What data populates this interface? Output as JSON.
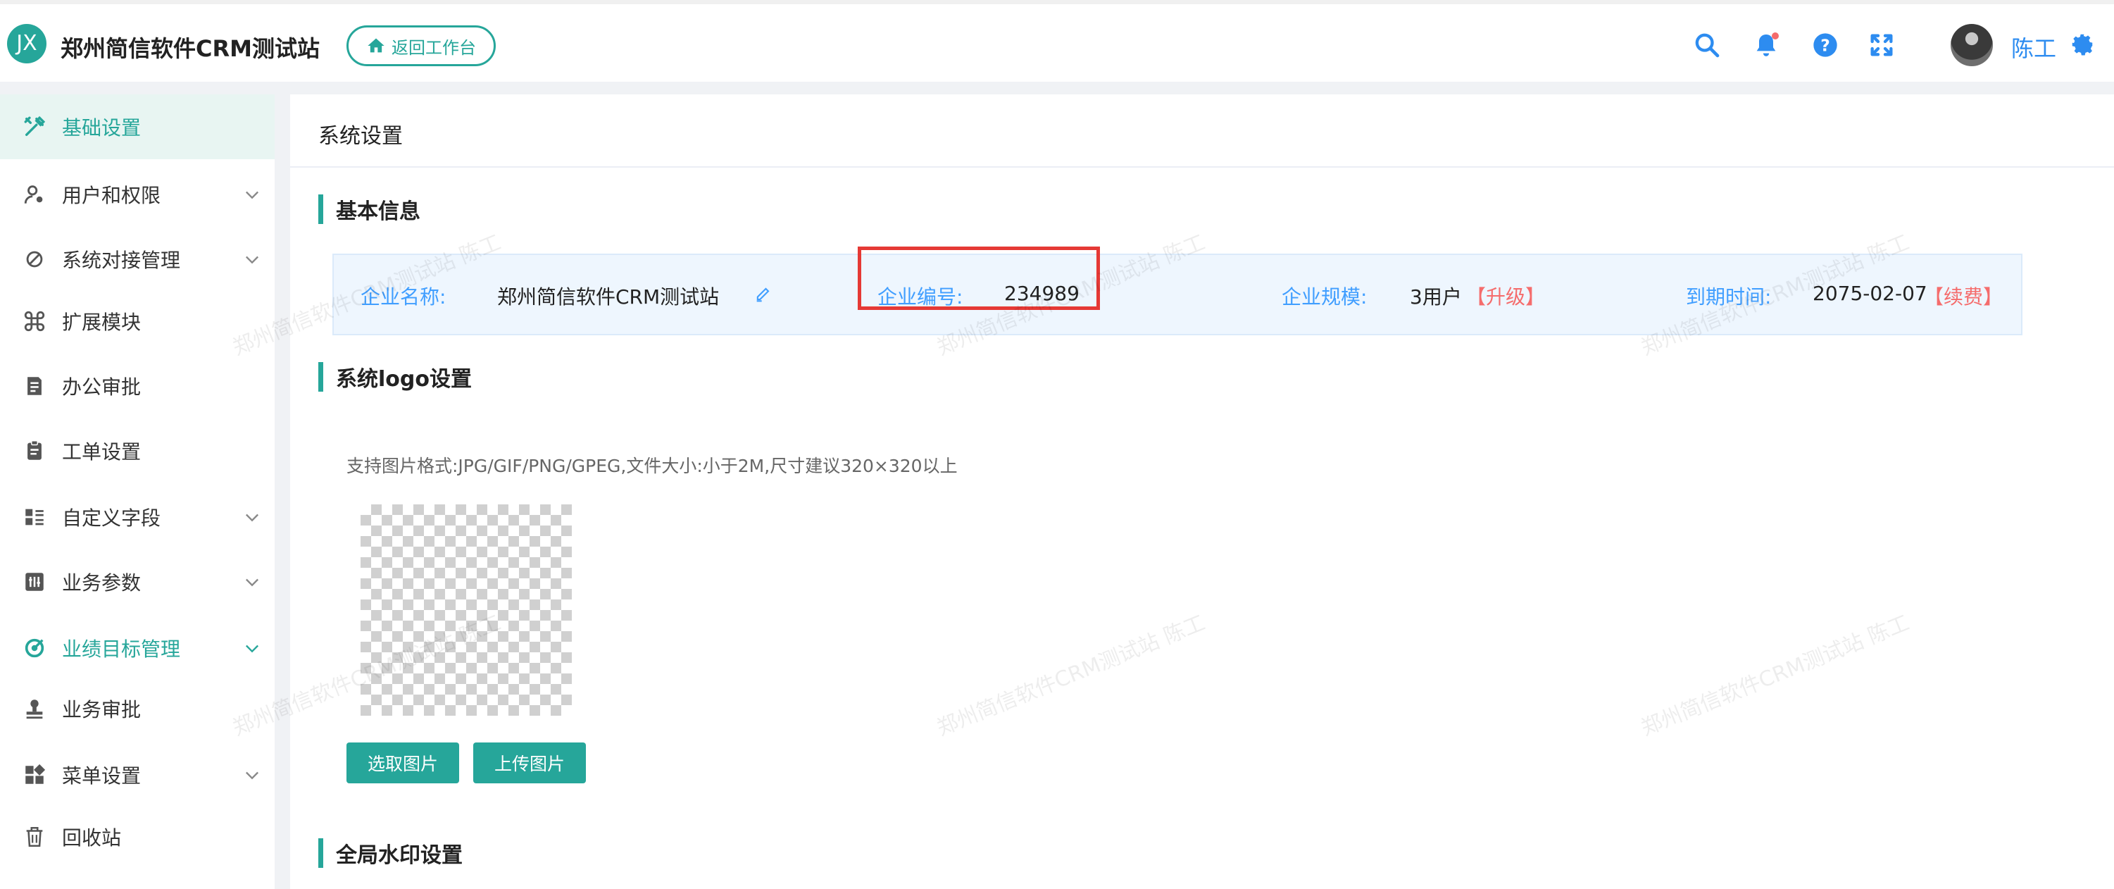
{
  "app": {
    "logo_text": "JX",
    "title": "郑州简信软件CRM测试站",
    "back_button": "返回工作台"
  },
  "header": {
    "icons": [
      "search-icon",
      "bell-icon",
      "help-icon",
      "fullscreen-icon",
      "gear-icon"
    ],
    "user_name": "陈工",
    "accent_color": "#26a69a",
    "link_color": "#2d8cf0"
  },
  "sidebar": {
    "items": [
      {
        "label": "基础设置",
        "icon": "wrench-icon",
        "active": true,
        "has_children": false
      },
      {
        "label": "用户和权限",
        "icon": "user-key-icon",
        "active": false,
        "has_children": true
      },
      {
        "label": "系统对接管理",
        "icon": "plug-icon",
        "active": false,
        "has_children": true
      },
      {
        "label": "扩展模块",
        "icon": "command-icon",
        "active": false,
        "has_children": false
      },
      {
        "label": "办公审批",
        "icon": "doc-approve-icon",
        "active": false,
        "has_children": false
      },
      {
        "label": "工单设置",
        "icon": "clipboard-icon",
        "active": false,
        "has_children": false
      },
      {
        "label": "自定义字段",
        "icon": "list-icon",
        "active": false,
        "has_children": true
      },
      {
        "label": "业务参数",
        "icon": "sliders-icon",
        "active": false,
        "has_children": true
      },
      {
        "label": "业绩目标管理",
        "icon": "target-icon",
        "active": false,
        "has_children": true,
        "highlight": true
      },
      {
        "label": "业务审批",
        "icon": "stamp-icon",
        "active": false,
        "has_children": false
      },
      {
        "label": "菜单设置",
        "icon": "grid-icon",
        "active": false,
        "has_children": true
      },
      {
        "label": "回收站",
        "icon": "trash-icon",
        "active": false,
        "has_children": false
      }
    ]
  },
  "main": {
    "title": "系统设置",
    "basic_info": {
      "section_title": "基本信息",
      "company_name_label": "企业名称:",
      "company_name": "郑州简信软件CRM测试站",
      "company_id_label": "企业编号:",
      "company_id": "234989",
      "scale_label": "企业规模:",
      "scale_value": "3用户",
      "scale_action": "【升级】",
      "expire_label": "到期时间:",
      "expire_value": "2075-02-07",
      "expire_action": "【续费】"
    },
    "logo": {
      "section_title": "系统logo设置",
      "hint": "支持图片格式:JPG/GIF/PNG/GPEG,文件大小:小于2M,尺寸建议320×320以上",
      "select_button": "选取图片",
      "upload_button": "上传图片"
    },
    "watermark": {
      "section_title": "全局水印设置",
      "text": "郑州简信软件CRM测试站 陈工"
    }
  }
}
